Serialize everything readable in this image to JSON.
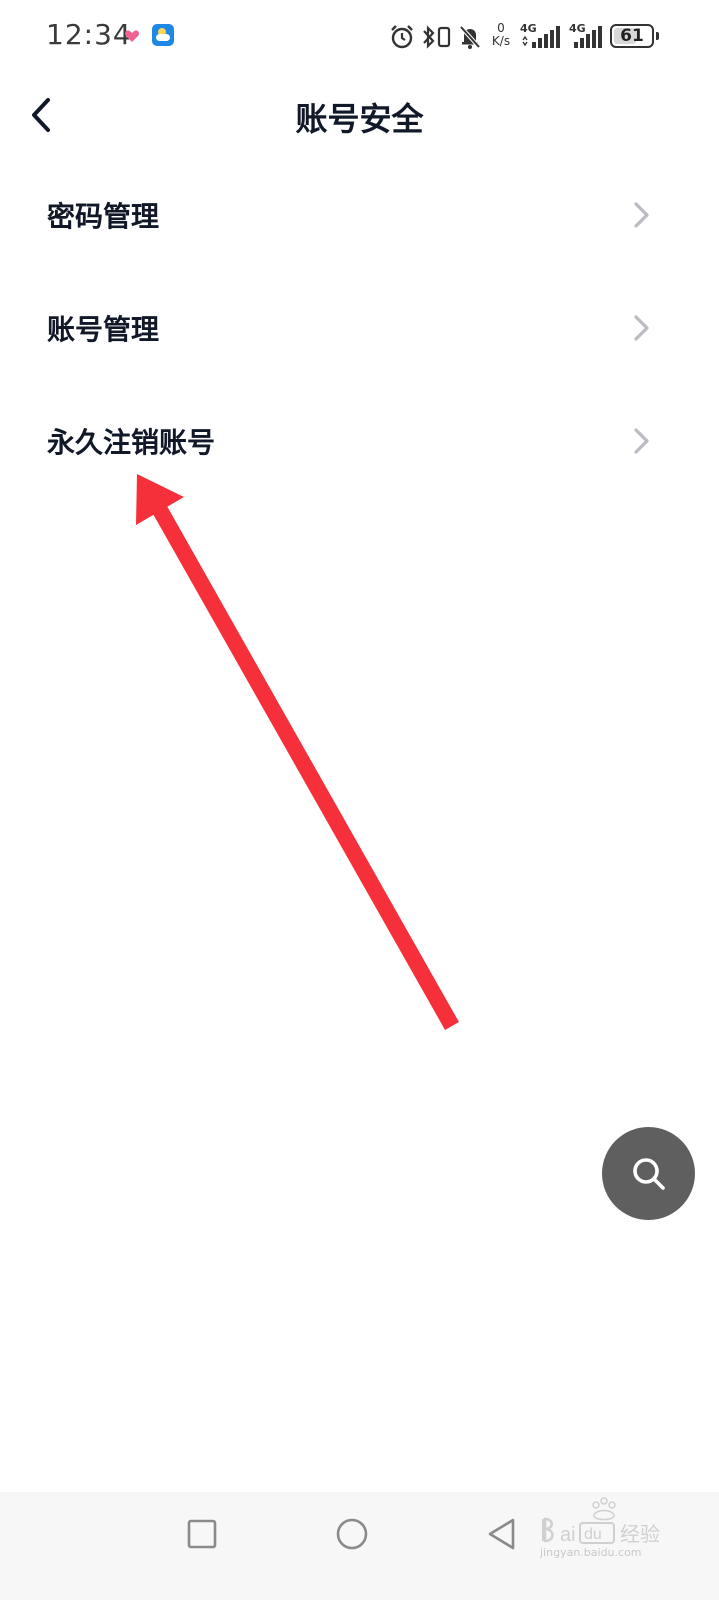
{
  "status_bar": {
    "time": "12:34",
    "net_speed_value": "0",
    "net_speed_unit": "K/s",
    "signal1_label": "4G",
    "signal2_label": "4G",
    "battery_level": "61",
    "battery_fraction": 0.61
  },
  "header": {
    "title": "账号安全"
  },
  "menu": {
    "items": [
      {
        "label": "密码管理"
      },
      {
        "label": "账号管理"
      },
      {
        "label": "永久注销账号"
      }
    ]
  },
  "watermark": {
    "text": "jingyan.baidu.com"
  },
  "colors": {
    "text_primary": "#111827",
    "chevron": "#b9bcc2",
    "annotation_arrow": "#f5303a",
    "fab_background": "#5f5f5f"
  },
  "icons": {
    "back": "chevron-left-icon",
    "menu_chevron": "chevron-right-icon",
    "fab": "search-icon",
    "nav": [
      "square-recent-icon",
      "circle-home-icon",
      "triangle-back-icon"
    ]
  }
}
